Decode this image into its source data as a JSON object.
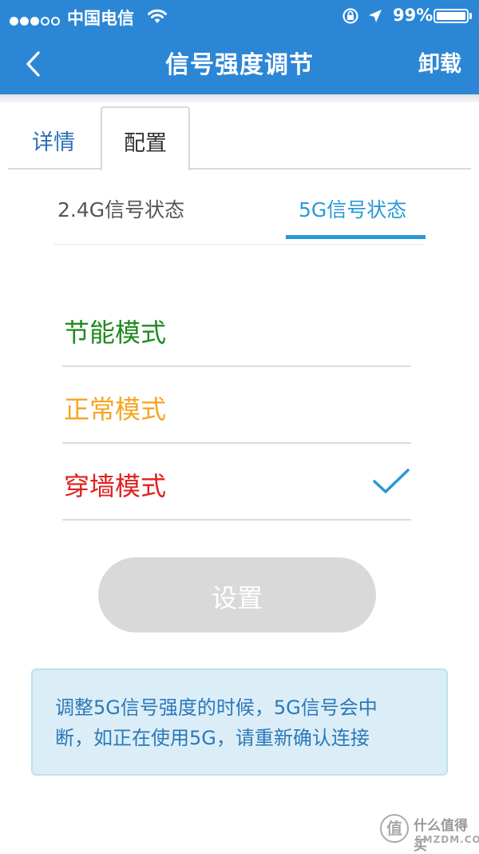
{
  "status_bar": {
    "carrier": "中国电信",
    "battery_percent": "99%",
    "battery_level": 0.99,
    "signal_bars_filled": 3,
    "signal_bars_total": 5
  },
  "nav": {
    "title": "信号强度调节",
    "right_action": "卸载",
    "back_icon": "chevron-left-icon"
  },
  "tabs": [
    {
      "label": "详情",
      "active": false
    },
    {
      "label": "配置",
      "active": true
    }
  ],
  "subtabs": [
    {
      "label": "2.4G信号状态",
      "active": false
    },
    {
      "label": "5G信号状态",
      "active": true
    }
  ],
  "modes": [
    {
      "label": "节能模式",
      "color": "#1f8a1f",
      "selected": false
    },
    {
      "label": "正常模式",
      "color": "#f5a623",
      "selected": false
    },
    {
      "label": "穿墙模式",
      "color": "#e02020",
      "selected": true
    }
  ],
  "set_button": {
    "label": "设置",
    "enabled": false
  },
  "notice": {
    "line1": "调整5G信号强度的时候，5G信号会中",
    "line2": "断，如正在使用5G，请重新确认连接"
  },
  "watermark": {
    "text": "什么值得买",
    "domain": "SMZDM.COM"
  },
  "colors": {
    "header": "#2b86d6",
    "accent": "#2a98d8",
    "notice_bg": "#dbeef7"
  }
}
